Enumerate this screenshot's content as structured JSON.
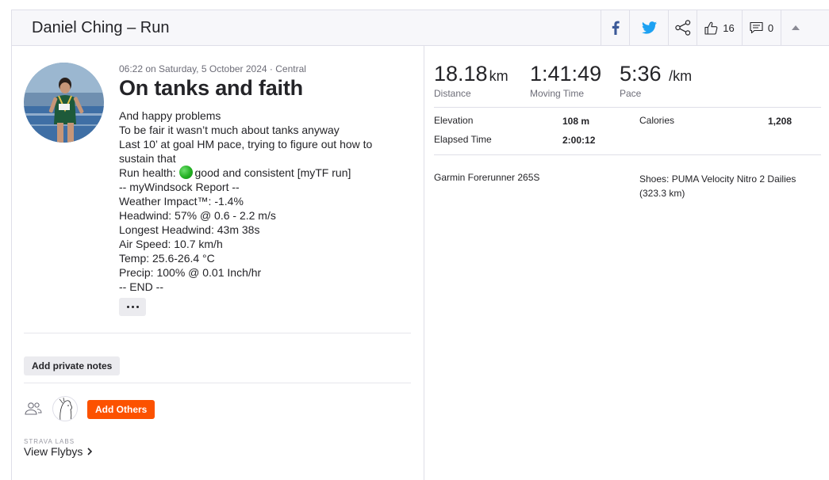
{
  "header": {
    "title": "Daniel Ching – Run",
    "kudos_count": "16",
    "comments_count": "0"
  },
  "activity": {
    "meta": "06:22 on Saturday, 5 October 2024 · Central",
    "title": "On tanks and faith",
    "description": {
      "line1": "And happy problems",
      "line2": "To be fair it wasn’t much about tanks anyway",
      "line3": "Last 10’ at goal HM pace, trying to figure out how to sustain that",
      "line4_prefix": "Run health:",
      "line4_suffix": "good and consistent [myTF run]",
      "line5": "-- myWindsock Report --",
      "line6": "Weather Impact™: -1.4%",
      "line7": "Headwind: 57% @ 0.6 - 2.2 m/s",
      "line8": "Longest Headwind: 43m 38s",
      "line9": "Air Speed: 10.7 km/h",
      "line10": "Temp: 25.6-26.4 °C",
      "line11": "Precip: 100% @ 0.01 Inch/hr",
      "line12": "-- END --"
    },
    "private_notes_label": "Add private notes",
    "add_others_label": "Add Others",
    "labs_label": "STRAVA LABS",
    "flybys_label": "View Flybys"
  },
  "stats": {
    "distance_value": "18.18",
    "distance_unit": "km",
    "distance_label": "Distance",
    "moving_time_value": "1:41:49",
    "moving_time_label": "Moving Time",
    "pace_value": "5:36",
    "pace_unit": "/km",
    "pace_label": "Pace",
    "elevation_label": "Elevation",
    "elevation_value": "108 m",
    "calories_label": "Calories",
    "calories_value": "1,208",
    "elapsed_label": "Elapsed Time",
    "elapsed_value": "2:00:12",
    "device": "Garmin Forerunner 265S",
    "shoes_line1": "Shoes: PUMA Velocity Nitro 2 Dailies",
    "shoes_line2": "(323.3 km)"
  },
  "colors": {
    "accent": "#fc5200",
    "facebook": "#3b5998",
    "twitter": "#1da1f2",
    "health_dot": "#23b023"
  },
  "icons": [
    "facebook-icon",
    "twitter-icon",
    "share-icon",
    "thumbs-up-icon",
    "comment-icon",
    "chevron-up-icon",
    "group-icon",
    "chevron-right-icon"
  ]
}
